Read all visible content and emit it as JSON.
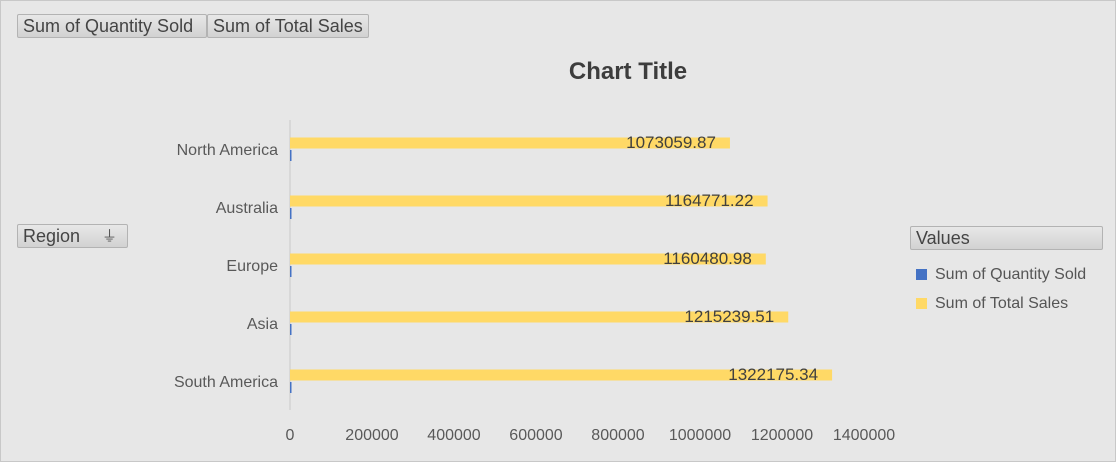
{
  "pivot": {
    "value_fields": [
      "Sum of Quantity Sold",
      "Sum of Total Sales"
    ],
    "axis_field": "Region",
    "legend_header": "Values"
  },
  "icons": {
    "region_filter": "filter-icon"
  },
  "colors": {
    "quantity": "#4472c4",
    "sales": "#ffd966",
    "axis": "#595959"
  },
  "chart_data": {
    "type": "bar",
    "orientation": "horizontal",
    "title": "Chart Title",
    "categories": [
      "North America",
      "Australia",
      "Europe",
      "Asia",
      "South America"
    ],
    "series": [
      {
        "name": "Sum of Quantity Sold",
        "values": [
          0,
          0,
          0,
          0,
          0
        ]
      },
      {
        "name": "Sum of Total Sales",
        "values": [
          1073059.87,
          1164771.22,
          1160480.98,
          1215239.51,
          1322175.34
        ]
      }
    ],
    "data_labels": [
      "1073059.87",
      "1164771.22",
      "1160480.98",
      "1215239.51",
      "1322175.34"
    ],
    "xlim": [
      0,
      1400000
    ],
    "xticks": [
      0,
      200000,
      400000,
      600000,
      800000,
      1000000,
      1200000,
      1400000
    ],
    "grid": false,
    "legend_position": "right"
  }
}
